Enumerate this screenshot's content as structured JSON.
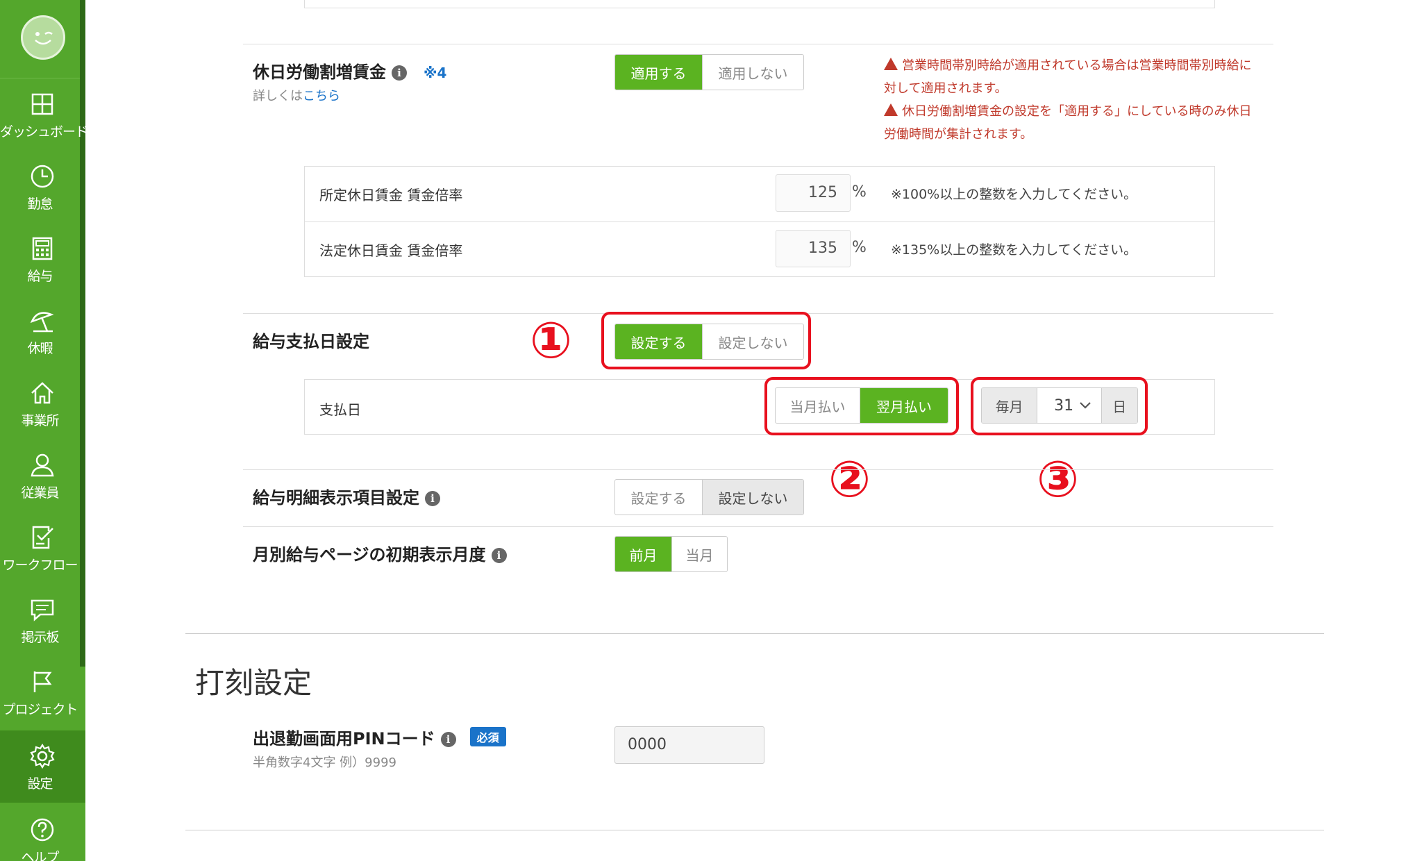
{
  "sidebar": {
    "items": [
      {
        "label": "ダッシュボード",
        "icon": "dashboard-icon"
      },
      {
        "label": "勤怠",
        "icon": "clock-icon"
      },
      {
        "label": "給与",
        "icon": "calculator-icon"
      },
      {
        "label": "休暇",
        "icon": "beach-umbrella-icon"
      },
      {
        "label": "事業所",
        "icon": "home-icon"
      },
      {
        "label": "従業員",
        "icon": "user-icon"
      },
      {
        "label": "ワークフロー",
        "icon": "checklist-icon"
      },
      {
        "label": "掲示板",
        "icon": "message-icon"
      },
      {
        "label": "プロジェクト",
        "icon": "flag-icon"
      },
      {
        "label": "設定",
        "icon": "gear-icon"
      },
      {
        "label": "ヘルプ",
        "icon": "help-icon"
      }
    ]
  },
  "holiday_wage": {
    "title": "休日労働割増賃金",
    "note": "※4",
    "detail_prefix": "詳しくは",
    "detail_link": "こちら",
    "toggle": {
      "apply": "適用する",
      "not_apply": "適用しない"
    },
    "warnings": [
      "営業時間帯別時給が適用されている場合は営業時間帯別時給に対して適用されます。",
      "休日労働割増賃金の設定を「適用する」にしている時のみ休日労働時間が集計されます。"
    ],
    "rows": [
      {
        "label": "所定休日賃金 賃金倍率",
        "value": "125",
        "unit": "%",
        "hint": "※100%以上の整数を入力してください。"
      },
      {
        "label": "法定休日賃金 賃金倍率",
        "value": "135",
        "unit": "%",
        "hint": "※135%以上の整数を入力してください。"
      }
    ]
  },
  "payday": {
    "title": "給与支払日設定",
    "toggle": {
      "set": "設定する",
      "not_set": "設定しない"
    },
    "row_label": "支払日",
    "timing": {
      "this_month": "当月払い",
      "next_month": "翌月払い"
    },
    "prefix": "毎月",
    "day_value": "31",
    "suffix": "日",
    "markers": [
      "①",
      "②",
      "③"
    ]
  },
  "payslip": {
    "title": "給与明細表示項目設定",
    "toggle": {
      "set": "設定する",
      "not_set": "設定しない"
    }
  },
  "monthly_page": {
    "title": "月別給与ページの初期表示月度",
    "toggle": {
      "prev": "前月",
      "current": "当月"
    }
  },
  "stamp": {
    "section_title": "打刻設定",
    "pin_title": "出退勤画面用PINコード",
    "required_badge": "必須",
    "pin_hint": "半角数字4文字 例）9999",
    "pin_value": "0000"
  },
  "colors": {
    "sidebar": "#54a72c",
    "active_green": "#5bb321",
    "annotation_red": "#e8101e",
    "link_blue": "#1a73c9"
  }
}
